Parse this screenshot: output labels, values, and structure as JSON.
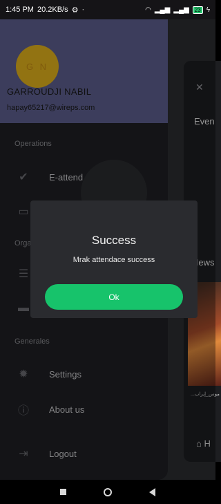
{
  "status_bar": {
    "time": "1:45 PM",
    "network_speed": "20.2KB/s",
    "battery": "23"
  },
  "drawer": {
    "avatar_initials": "G N",
    "user_name": "GARROUDJI NABIL",
    "user_email": "hapay65217@wireps.com",
    "sections": {
      "operations": "Operations",
      "organization": "Orga",
      "generales": "Generales"
    },
    "items": {
      "e_attendance": "E-attend",
      "settings": "Settings",
      "about": "About us",
      "logout": "Logout"
    }
  },
  "background_screen": {
    "events_label": "Even",
    "news_label": "News",
    "news_caption": "موس_إيراب...",
    "home_label": "H"
  },
  "dialog": {
    "title": "Success",
    "message": "Mrak attendace success",
    "ok_label": "Ok"
  },
  "colors": {
    "drawer_header": "#5d5f8e",
    "avatar": "#e0b11d",
    "ok_button": "#17c36b",
    "dialog_bg": "#2a2b2f"
  }
}
